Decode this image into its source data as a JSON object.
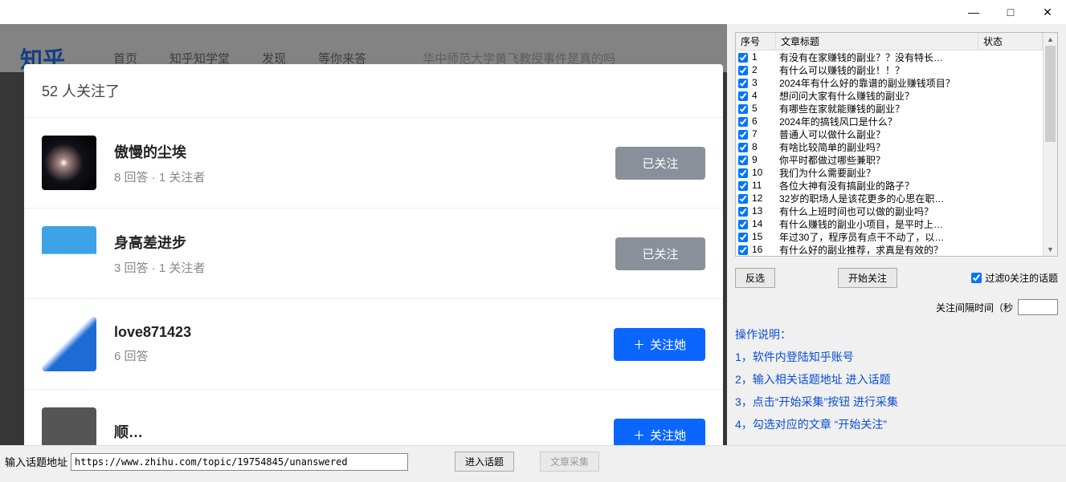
{
  "titlebar": {
    "minimize": "—",
    "maximize": "□",
    "close": "✕"
  },
  "backdrop": {
    "logo": "知乎",
    "nav": [
      "首页",
      "知乎知学堂",
      "发现",
      "等你来答"
    ],
    "search_hint": "华中师范大学黄飞教授事件是真的吗"
  },
  "modal": {
    "title": "52 人关注了",
    "followed_label": "已关注",
    "follow_her_label": "关注她",
    "plus": "＋",
    "users": [
      {
        "name": "傲慢的尘埃",
        "stats": "8 回答 · 1 关注者",
        "btn": "followed",
        "avatar_bg": "radial-gradient(circle at 40% 50%, #fff 0%, #a88 10%, #121018 45%, #000 100%)"
      },
      {
        "name": "身高差进步",
        "stats": "3 回答 · 1 关注者",
        "btn": "followed",
        "avatar_bg": "linear-gradient(180deg, #3da2e6 0%, #3da2e6 50%, #fff 52%, #fff 100%)"
      },
      {
        "name": "love871423",
        "stats": "6 回答",
        "btn": "primary",
        "avatar_bg": "linear-gradient(135deg, #fff 0%, #fff 45%, #1e6bd6 55%, #1e6bd6 100%)"
      },
      {
        "name": "顺…",
        "stats": "",
        "btn": "primary",
        "avatar_bg": "#555"
      }
    ]
  },
  "table": {
    "headers": {
      "seq": "序号",
      "title": "文章标题",
      "status": "状态"
    },
    "rows": [
      {
        "n": "1",
        "t": "有没有在家赚钱的副业？？没有特长…"
      },
      {
        "n": "2",
        "t": "有什么可以赚钱的副业！！？"
      },
      {
        "n": "3",
        "t": "2024年有什么好的靠谱的副业赚钱项目？"
      },
      {
        "n": "4",
        "t": "想问问大家有什么赚钱的副业？"
      },
      {
        "n": "5",
        "t": "有哪些在家就能赚钱的副业？"
      },
      {
        "n": "6",
        "t": "2024年的搞钱风口是什么？"
      },
      {
        "n": "7",
        "t": "普通人可以做什么副业？"
      },
      {
        "n": "8",
        "t": "有啥比较简单的副业吗？"
      },
      {
        "n": "9",
        "t": "你平时都做过哪些兼职？"
      },
      {
        "n": "10",
        "t": "我们为什么需要副业？"
      },
      {
        "n": "11",
        "t": "各位大神有没有搞副业的路子？"
      },
      {
        "n": "12",
        "t": "32岁的职场人是该花更多的心思在职…"
      },
      {
        "n": "13",
        "t": "有什么上班时间也可以做的副业吗？"
      },
      {
        "n": "14",
        "t": "有什么赚钱的副业小项目，是平时上…"
      },
      {
        "n": "15",
        "t": "年过30了，程序员有点干不动了，以…"
      },
      {
        "n": "16",
        "t": "有什么好的副业推荐，求真是有效的？"
      }
    ]
  },
  "controls": {
    "invert": "反选",
    "start_follow": "开始关注",
    "filter_zero": "过滤0关注的话题",
    "interval_label": "关注间隔时间（秒"
  },
  "instructions": {
    "heading": "操作说明：",
    "lines": [
      "1，软件内登陆知乎账号",
      "2，输入相关话题地址 进入话题",
      "3，点击“开始采集”按钮 进行采集",
      "4，勾选对应的文章 “开始关注”"
    ]
  },
  "bottom": {
    "label": "输入话题地址",
    "url": "https://www.zhihu.com/topic/19754845/unanswered",
    "enter_topic": "进入话题",
    "collect": "文章采集"
  }
}
